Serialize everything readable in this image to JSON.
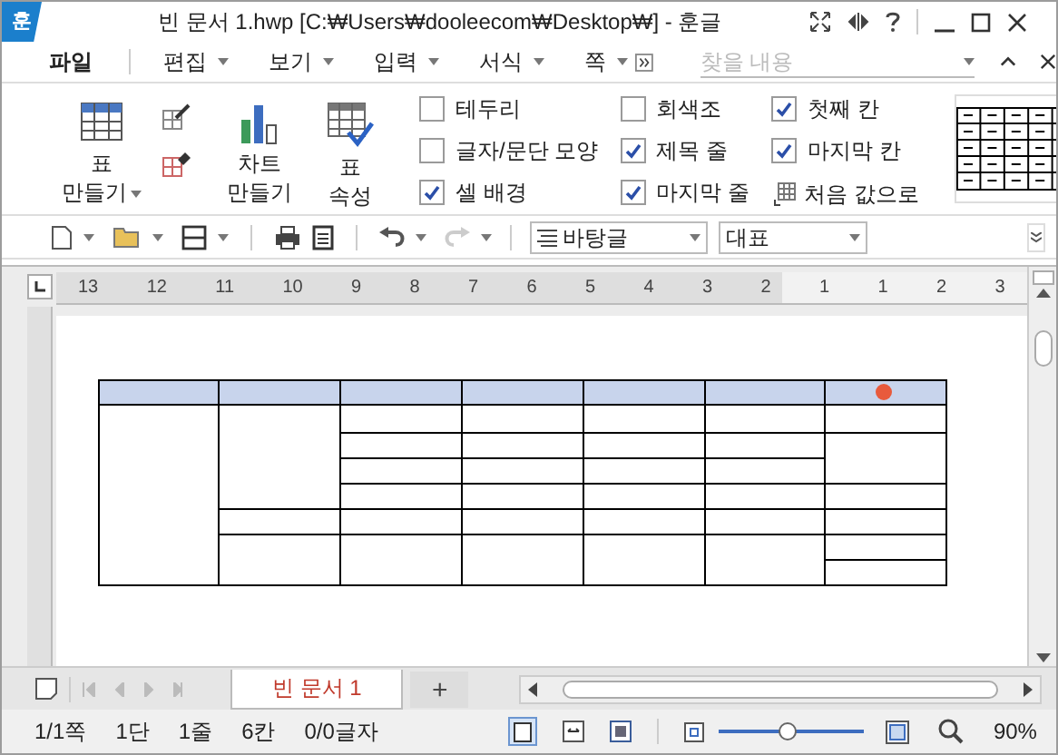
{
  "title_bar": {
    "logo": "훈",
    "title": "빈 문서 1.hwp [C:₩Users₩dooleecom₩Desktop₩] - 훈글"
  },
  "menu": {
    "items": [
      {
        "label": "파일",
        "dropdown": false
      },
      {
        "label": "편집",
        "dropdown": true
      },
      {
        "label": "보기",
        "dropdown": true
      },
      {
        "label": "입력",
        "dropdown": true
      },
      {
        "label": "서식",
        "dropdown": true
      },
      {
        "label": "쪽",
        "dropdown": true
      }
    ],
    "search": {
      "placeholder": "찾을 내용"
    }
  },
  "ribbon": {
    "big_buttons": [
      {
        "kind": "table",
        "label": "표\n만들기",
        "dropdown": true
      },
      {
        "kind": "chart",
        "label": "차트\n만들기",
        "dropdown": false
      },
      {
        "kind": "props",
        "label": "표\n속성",
        "dropdown": false
      }
    ],
    "options": [
      {
        "kind": "check",
        "label": "테두리",
        "checked": false
      },
      {
        "kind": "check",
        "label": "글자/문단 모양",
        "checked": false
      },
      {
        "kind": "check",
        "label": "셀 배경",
        "checked": true
      },
      {
        "kind": "check",
        "label": "회색조",
        "checked": false
      },
      {
        "kind": "check",
        "label": "제목 줄",
        "checked": true
      },
      {
        "kind": "check",
        "label": "마지막 줄",
        "checked": true
      },
      {
        "kind": "check",
        "label": "첫째 칸",
        "checked": true
      },
      {
        "kind": "check",
        "label": "마지막 칸",
        "checked": true
      },
      {
        "kind": "action",
        "label": "처음 값으로"
      }
    ]
  },
  "toolbar": {
    "style": "바탕글",
    "font": "대표"
  },
  "ruler": {
    "numbers": [
      "13",
      "12",
      "11",
      "10",
      "9",
      "8",
      "7",
      "6",
      "5",
      "4",
      "3",
      "2",
      "1",
      "1",
      "2",
      "3"
    ]
  },
  "tabs": [
    {
      "label": "빈 문서 1",
      "selected": true
    }
  ],
  "add_tab": "+",
  "status_bar": {
    "items": [
      "1/1쪽",
      "1단",
      "1줄",
      "6칸",
      "0/0글자"
    ],
    "zoom": {
      "level": 0.47,
      "reading": "90%"
    }
  }
}
